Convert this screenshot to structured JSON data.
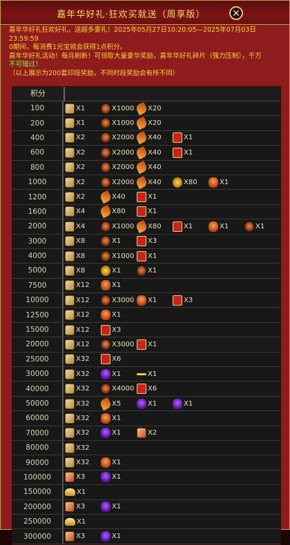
{
  "window": {
    "title": "嘉年华好礼·狂欢买就送（周享版）",
    "close_label": "✕"
  },
  "info": {
    "line1": "嘉年华好礼狂欢好礼，送超多豪礼！2025年05月27日10:20:05—2025年07月03日23:59:59",
    "line2": "0期间，每消费1元宝就会获得1点积分。",
    "line3": "  嘉年华好礼活动！每月刷新！可领取大量豪华奖励，嘉年华好礼碎片（强力压制），千万",
    "line4": "不可错过！",
    "line5": "（以上展示为200套印段奖励，不同时段奖励会有所不同）"
  },
  "table": {
    "header_label": "积分",
    "rows": [
      {
        "score": "100",
        "rewards": [
          {
            "icon": "scroll-icon",
            "qty": "X1"
          },
          {
            "icon": "coin-bag-icon",
            "qty": "X1000"
          },
          {
            "icon": "feather-icon",
            "qty": "X20"
          }
        ]
      },
      {
        "score": "200",
        "rewards": [
          {
            "icon": "scroll-icon",
            "qty": "X1"
          },
          {
            "icon": "coin-bag-icon",
            "qty": "X1000"
          },
          {
            "icon": "feather-icon",
            "qty": "X20"
          }
        ]
      },
      {
        "score": "400",
        "rewards": [
          {
            "icon": "scroll-icon",
            "qty": "X2"
          },
          {
            "icon": "coin-bag-icon",
            "qty": "X2000"
          },
          {
            "icon": "feather-icon",
            "qty": "X40"
          },
          {
            "icon": "giftbox-icon",
            "qty": "X1"
          }
        ]
      },
      {
        "score": "600",
        "rewards": [
          {
            "icon": "scroll-icon",
            "qty": "X2"
          },
          {
            "icon": "coin-bag-icon",
            "qty": "X2000"
          },
          {
            "icon": "feather-icon",
            "qty": "X40"
          },
          {
            "icon": "giftbox-icon",
            "qty": "X1"
          }
        ]
      },
      {
        "score": "800",
        "rewards": [
          {
            "icon": "scroll-icon",
            "qty": "X2"
          },
          {
            "icon": "coin-bag-icon",
            "qty": "X2000"
          },
          {
            "icon": "feather-icon",
            "qty": "X40"
          }
        ]
      },
      {
        "score": "1000",
        "rewards": [
          {
            "icon": "scroll-icon",
            "qty": "X2"
          },
          {
            "icon": "coin-bag-icon",
            "qty": "X2000"
          },
          {
            "icon": "feather-icon",
            "qty": "X40"
          },
          {
            "icon": "coin-pile-icon",
            "qty": "X80"
          },
          {
            "icon": "orange-bag-icon",
            "qty": "X1"
          }
        ]
      },
      {
        "score": "1200",
        "rewards": [
          {
            "icon": "scroll-icon",
            "qty": "X2"
          },
          {
            "icon": "feather-icon",
            "qty": "X40"
          },
          {
            "icon": "giftbox-icon",
            "qty": "X1"
          }
        ]
      },
      {
        "score": "1600",
        "rewards": [
          {
            "icon": "scroll-icon",
            "qty": "X4"
          },
          {
            "icon": "feather-icon",
            "qty": "X80"
          },
          {
            "icon": "giftbox-icon",
            "qty": "X1"
          }
        ]
      },
      {
        "score": "2000",
        "rewards": [
          {
            "icon": "scroll-icon",
            "qty": "X4"
          },
          {
            "icon": "coin-bag-icon",
            "qty": "X1000"
          },
          {
            "icon": "feather-icon",
            "qty": "X80"
          },
          {
            "icon": "giftbox-icon",
            "qty": "X1"
          },
          {
            "icon": "orange-bag-icon",
            "qty": "X1"
          },
          {
            "icon": "coin-bag-icon",
            "qty": "X1"
          }
        ]
      },
      {
        "score": "3000",
        "rewards": [
          {
            "icon": "scroll-icon",
            "qty": "X8"
          },
          {
            "icon": "coin-bag-icon",
            "qty": "X1"
          },
          {
            "icon": "giftbox-icon",
            "qty": "X3"
          }
        ]
      },
      {
        "score": "4000",
        "rewards": [
          {
            "icon": "scroll-icon",
            "qty": "X8"
          },
          {
            "icon": "coin-bag-icon",
            "qty": "X1000"
          },
          {
            "icon": "giftbox-icon",
            "qty": "X1"
          }
        ]
      },
      {
        "score": "5000",
        "rewards": [
          {
            "icon": "scroll-icon",
            "qty": "X8"
          },
          {
            "icon": "coin-pile-icon",
            "qty": "X1"
          },
          {
            "icon": "coin-bag-icon",
            "qty": "X1"
          }
        ]
      },
      {
        "score": "7500",
        "rewards": [
          {
            "icon": "scroll-icon",
            "qty": "X12"
          },
          {
            "icon": "orange-bag-icon",
            "qty": "X1"
          }
        ]
      },
      {
        "score": "10000",
        "rewards": [
          {
            "icon": "scroll-icon",
            "qty": "X12"
          },
          {
            "icon": "coin-bag-icon",
            "qty": "X3000"
          },
          {
            "icon": "orange-bag-icon",
            "qty": "X1"
          },
          {
            "icon": "giftbox-icon",
            "qty": "X3"
          }
        ]
      },
      {
        "score": "12500",
        "rewards": [
          {
            "icon": "scroll-icon",
            "qty": "X12"
          },
          {
            "icon": "orange-bag-icon",
            "qty": "X1"
          }
        ]
      },
      {
        "score": "15000",
        "rewards": [
          {
            "icon": "scroll-icon",
            "qty": "X12"
          },
          {
            "icon": "giftbox-icon",
            "qty": "X3"
          }
        ]
      },
      {
        "score": "20000",
        "rewards": [
          {
            "icon": "scroll-icon",
            "qty": "X12"
          },
          {
            "icon": "coin-bag-icon",
            "qty": "X3000"
          },
          {
            "icon": "giftbox-icon",
            "qty": "X1"
          }
        ]
      },
      {
        "score": "25000",
        "rewards": [
          {
            "icon": "scroll-icon",
            "qty": "X32"
          },
          {
            "icon": "giftbox-icon",
            "qty": "X6"
          }
        ]
      },
      {
        "score": "30000",
        "rewards": [
          {
            "icon": "scroll-icon",
            "qty": "X32"
          },
          {
            "icon": "purple-bag-icon",
            "qty": "X1"
          },
          {
            "icon": "key-icon",
            "qty": "X1"
          }
        ]
      },
      {
        "score": "40000",
        "rewards": [
          {
            "icon": "scroll-icon",
            "qty": "X32"
          },
          {
            "icon": "coin-bag-icon",
            "qty": "X4000"
          },
          {
            "icon": "giftbox-icon",
            "qty": "X6"
          }
        ]
      },
      {
        "score": "50000",
        "rewards": [
          {
            "icon": "scroll-icon",
            "qty": "X32"
          },
          {
            "icon": "feather-icon",
            "qty": "X5"
          },
          {
            "icon": "purple-bag-icon",
            "qty": "X1"
          },
          {
            "icon": "purple-bag-icon",
            "qty": "X1"
          }
        ]
      },
      {
        "score": "60000",
        "rewards": [
          {
            "icon": "scroll-icon",
            "qty": "X32"
          },
          {
            "icon": "orange-bag-icon",
            "qty": "X1"
          }
        ]
      },
      {
        "score": "70000",
        "rewards": [
          {
            "icon": "scroll-icon",
            "qty": "X32"
          },
          {
            "icon": "purple-bag-icon",
            "qty": "X1"
          },
          {
            "icon": "scroll-red-icon",
            "qty": "X2"
          }
        ]
      },
      {
        "score": "80000",
        "rewards": [
          {
            "icon": "scroll-icon",
            "qty": "X32"
          }
        ]
      },
      {
        "score": "90000",
        "rewards": [
          {
            "icon": "scroll-icon",
            "qty": "X32"
          },
          {
            "icon": "orange-bag-icon",
            "qty": "X1"
          }
        ]
      },
      {
        "score": "100000",
        "rewards": [
          {
            "icon": "scroll-red-icon",
            "qty": "X3"
          },
          {
            "icon": "purple-bag-icon",
            "qty": "X1"
          }
        ]
      },
      {
        "score": "150000",
        "rewards": [
          {
            "icon": "gold-ingot-icon",
            "qty": "X1"
          }
        ]
      },
      {
        "score": "200000",
        "rewards": [
          {
            "icon": "scroll-red-icon",
            "qty": "X3"
          },
          {
            "icon": "purple-bag-icon",
            "qty": "X1"
          }
        ]
      },
      {
        "score": "250000",
        "rewards": [
          {
            "icon": "gold-ingot-icon",
            "qty": "X1"
          }
        ]
      },
      {
        "score": "300000",
        "rewards": [
          {
            "icon": "scroll-red-icon",
            "qty": "X3"
          },
          {
            "icon": "purple-bag-icon",
            "qty": "X1"
          }
        ]
      }
    ]
  },
  "colors": {
    "panel_bg": "#8e1c1c",
    "title_text": "#f5d76e",
    "info_text": "#ffd23a",
    "highlight_text": "#7dff4a",
    "row_bg": "#181818"
  }
}
